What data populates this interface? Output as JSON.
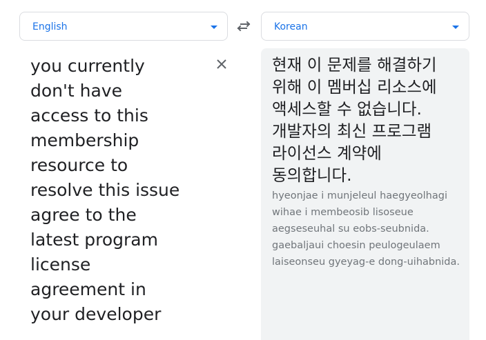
{
  "source_language": {
    "label": "English"
  },
  "target_language": {
    "label": "Korean"
  },
  "source": {
    "text": "you currently\ndon't have\naccess to this\nmembership\nresource to\nresolve this issue\nagree to the\nlatest program\nlicense\nagreement in\nyour developer"
  },
  "translation": {
    "text": "현재 이 문제를 해결하기 위해 이 멤버십 리소스에 액세스할 수 없습니다. 개발자의 최신 프로그램 라이선스 계약에 동의합니다.",
    "romanization": "hyeonjae i munjeleul haegyeolhagi\nwihae i membeosib lisoseue\naegseseuhal su eobs-seubnida.\ngaebaljaui choesin peulogeulaem\nlaiseonseu gyeyag-e dong-uihabnida."
  },
  "icons": {
    "swap": "swap-arrows-icon",
    "clear": "close-icon",
    "dropdown": "triangle-down-icon"
  },
  "colors": {
    "accent": "#1a73e8",
    "panel_bg": "#f1f3f4",
    "text": "#202124",
    "muted": "#70757a"
  }
}
